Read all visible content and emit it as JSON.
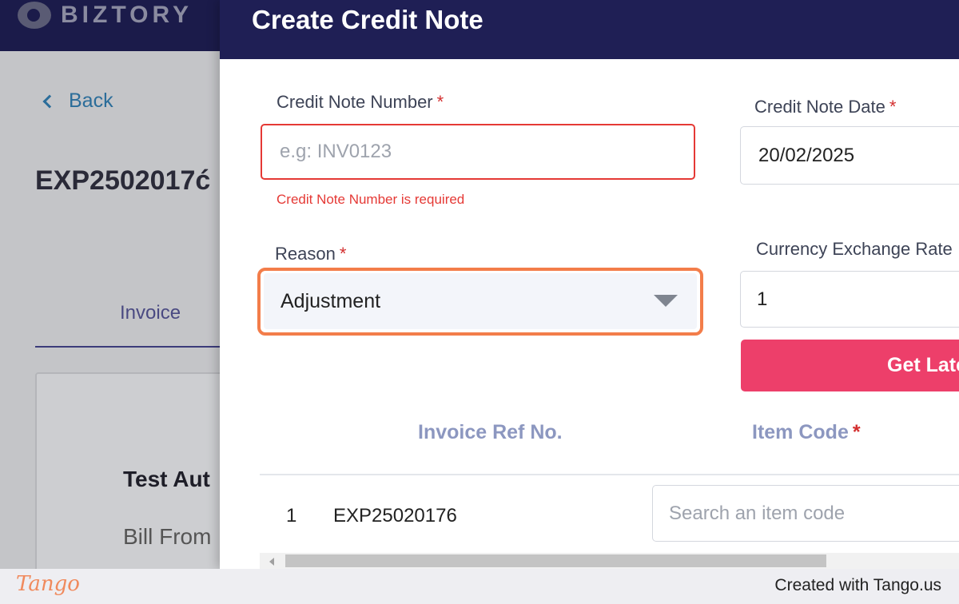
{
  "background": {
    "logo_text": "BIZTORY",
    "back_label": "Back",
    "doc_title": "EXP2502017ć",
    "tab_label": "Invoice",
    "card_name": "Test Aut",
    "card_sub": "Bill From"
  },
  "modal": {
    "title": "Create Credit Note",
    "credit_note_number": {
      "label": "Credit Note Number",
      "required_mark": "*",
      "value": "",
      "placeholder": "e.g: INV0123",
      "error": "Credit Note Number is required"
    },
    "credit_note_date": {
      "label": "Credit Note Date",
      "required_mark": "*",
      "value": "20/02/2025"
    },
    "reason": {
      "label": "Reason",
      "required_mark": "*",
      "selected": "Adjustment"
    },
    "exchange_rate": {
      "label": "Currency Exchange Rate",
      "value": "1"
    },
    "get_latest_button": "Get Late",
    "table": {
      "headers": [
        {
          "label": "Invoice Ref No.",
          "required": false
        },
        {
          "label": "Item Code",
          "required": true,
          "required_mark": "*"
        }
      ],
      "rows": [
        {
          "index": "1",
          "invoice_ref": "EXP25020176",
          "item_code_placeholder": "Search an item code"
        }
      ]
    }
  },
  "footer": {
    "logo": "Tango",
    "credit": "Created with Tango.us"
  },
  "colors": {
    "header_navy": "#1f1f55",
    "primary_pink": "#ed3f6a",
    "error_red": "#e53935",
    "highlight_orange": "#f37d4a",
    "table_header": "#8c97c0"
  }
}
